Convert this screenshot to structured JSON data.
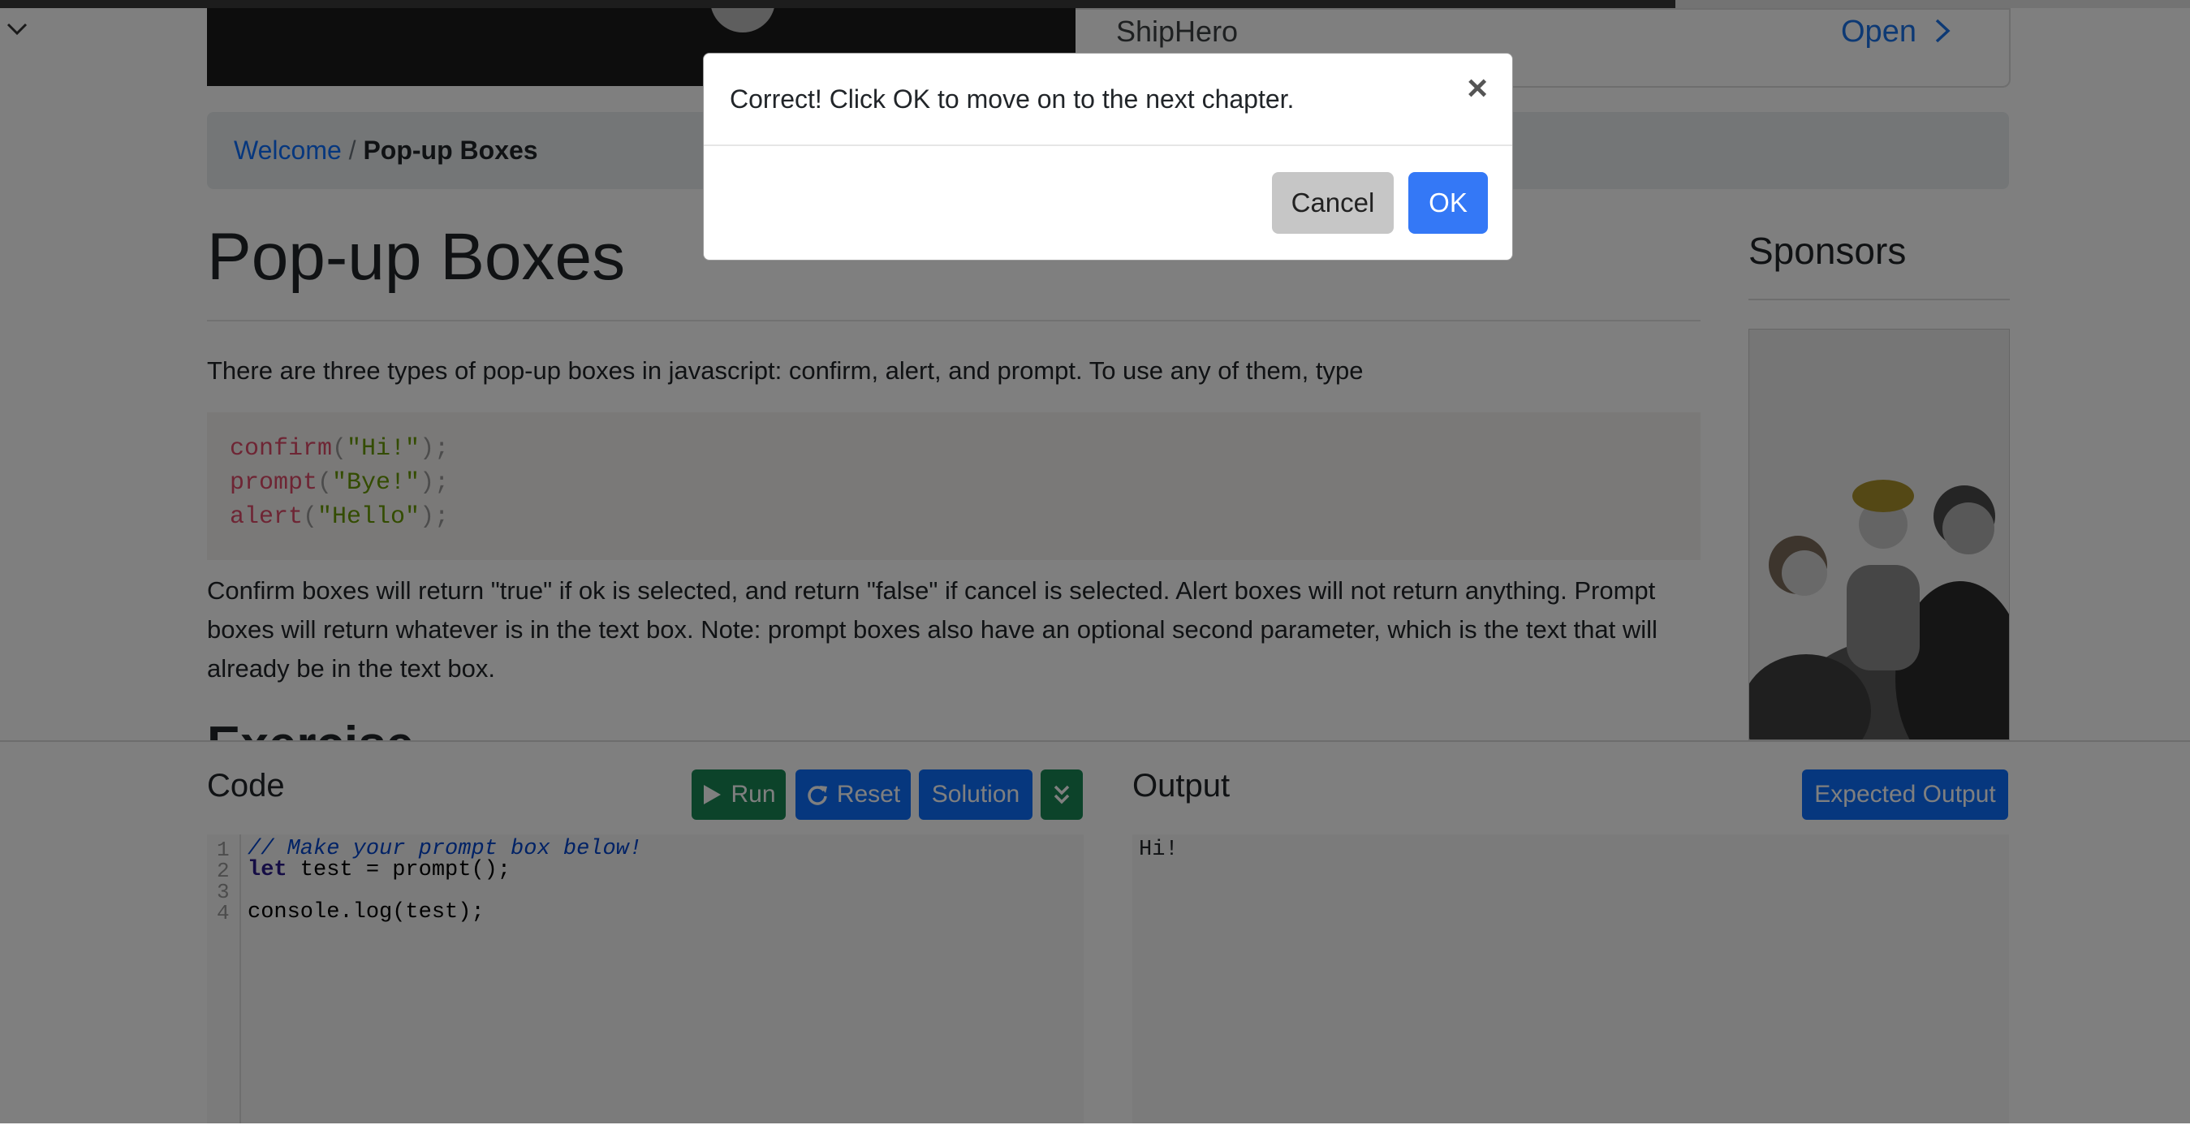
{
  "ad_banner": {
    "advertiser": "ShipHero",
    "open_label": "Open"
  },
  "breadcrumb": {
    "home": "Welcome",
    "separator": "/",
    "current": "Pop-up Boxes"
  },
  "page": {
    "title": "Pop-up Boxes",
    "intro": "There are three types of pop-up boxes in javascript: confirm, alert, and prompt. To use any of them, type",
    "code_example": [
      {
        "fn": "confirm",
        "open": "(",
        "arg": "\"Hi!\"",
        "close": ");"
      },
      {
        "fn": "prompt",
        "open": "(",
        "arg": "\"Bye!\"",
        "close": ");"
      },
      {
        "fn": "alert",
        "open": "(",
        "arg": "\"Hello\"",
        "close": ");"
      }
    ],
    "explanation": "Confirm boxes will return \"true\" if ok is selected, and return \"false\" if cancel is selected. Alert boxes will not return anything. Prompt boxes will return whatever is in the text box. Note: prompt boxes also have an optional second parameter, which is the text that will already be in the text box.",
    "next_heading": "Exercise"
  },
  "sidebar": {
    "title": "Sponsors"
  },
  "editor": {
    "title": "Code",
    "run_label": "Run",
    "reset_label": "Reset",
    "solution_label": "Solution",
    "line_numbers": [
      "1",
      "2",
      "3",
      "4"
    ],
    "lines": {
      "l1": "// Make your prompt box below!",
      "l2_kw": "let",
      "l2_rest": " test = prompt();",
      "l4": "console.log(test);"
    }
  },
  "output": {
    "title": "Output",
    "expected_label": "Expected Output",
    "text": "Hi!"
  },
  "modal": {
    "message": "Correct! Click OK to move on to the next chapter.",
    "close_symbol": "×",
    "cancel_label": "Cancel",
    "ok_label": "OK"
  },
  "colors": {
    "primary": "#0d6efd",
    "success": "#198754",
    "ok_button": "#3478f6",
    "cancel_button": "#c6c6c6",
    "overlay": "rgba(0,0,0,0.5)"
  }
}
